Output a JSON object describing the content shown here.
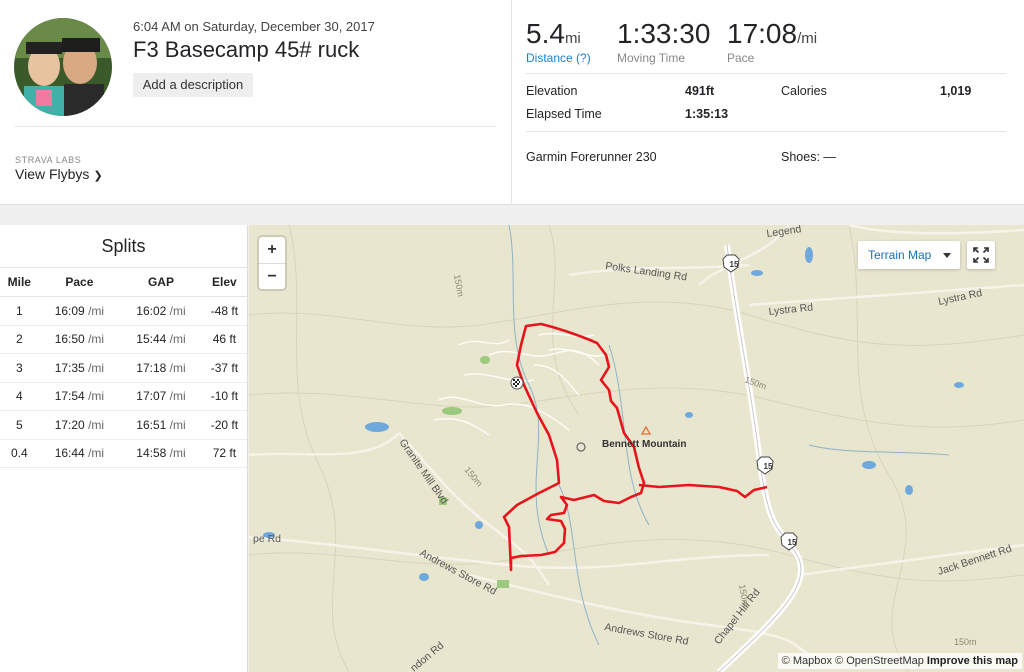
{
  "activity": {
    "datetime": "6:04 AM on Saturday, December 30, 2017",
    "title": "F3 Basecamp 45# ruck",
    "add_description": "Add a description",
    "labs_label": "STRAVA LABS",
    "flybys_label": "View Flybys"
  },
  "stats": {
    "distance": {
      "value": "5.4",
      "unit": "mi",
      "label": "Distance (?)"
    },
    "moving_time": {
      "value": "1:33:30",
      "label": "Moving Time"
    },
    "pace": {
      "value": "17:08",
      "unit": "/mi",
      "label": "Pace"
    }
  },
  "more_stats": {
    "elevation": {
      "label": "Elevation",
      "value": "491ft"
    },
    "calories": {
      "label": "Calories",
      "value": "1,019"
    },
    "elapsed": {
      "label": "Elapsed Time",
      "value": "1:35:13"
    },
    "device": "Garmin Forerunner 230",
    "shoes": "Shoes: —"
  },
  "splits": {
    "title": "Splits",
    "columns": [
      "Mile",
      "Pace",
      "GAP",
      "Elev"
    ],
    "rows": [
      {
        "mile": "1",
        "pace": "16:09",
        "gap": "16:02",
        "elev": "-48 ft"
      },
      {
        "mile": "2",
        "pace": "16:50",
        "gap": "15:44",
        "elev": "46 ft"
      },
      {
        "mile": "3",
        "pace": "17:35",
        "gap": "17:18",
        "elev": "-37 ft"
      },
      {
        "mile": "4",
        "pace": "17:54",
        "gap": "17:07",
        "elev": "-10 ft"
      },
      {
        "mile": "5",
        "pace": "17:20",
        "gap": "16:51",
        "elev": "-20 ft"
      },
      {
        "mile": "0.4",
        "pace": "16:44",
        "gap": "14:58",
        "elev": "72 ft"
      }
    ],
    "pace_unit": "/mi"
  },
  "map": {
    "zoom_in": "+",
    "zoom_out": "−",
    "map_type": "Terrain Map",
    "labels": {
      "polks": "Polks Landing Rd",
      "lystra": "Lystra Rd",
      "legend": "Legend",
      "bennett_mtn": "Bennett Mountain",
      "granite": "Granite Mill Blvd",
      "andrews1": "Andrews Store Rd",
      "andrews2": "Andrews Store Rd",
      "jack": "Jack Bennett Rd",
      "chapel": "Chapel Hill Rd",
      "pope": "pe Rd",
      "lndon": "ndon Rd",
      "c150a": "150m",
      "c150b": "150m",
      "c150c": "150m",
      "c150d": "150m",
      "c150e": "150m",
      "shield": "15"
    },
    "attribution": {
      "mapbox": "© Mapbox",
      "osm": "© OpenStreetMap",
      "improve": "Improve this map"
    },
    "route_color": "#e8141c",
    "road_color": "#ffffff",
    "water_color": "#6fa8dc"
  }
}
